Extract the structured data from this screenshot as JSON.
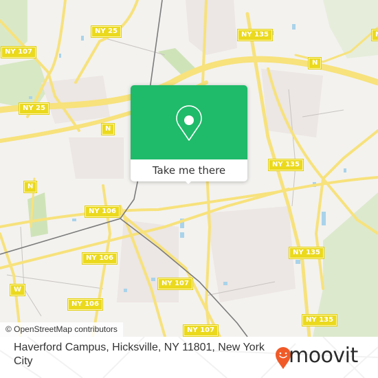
{
  "map": {
    "road_labels": [
      {
        "id": "ny25-top",
        "text": "NY 25"
      },
      {
        "id": "ny107-left",
        "text": "NY 107"
      },
      {
        "id": "ny25-left",
        "text": "NY 25"
      },
      {
        "id": "n-center-left",
        "text": "N"
      },
      {
        "id": "n-left",
        "text": "N"
      },
      {
        "id": "ny135-top",
        "text": "NY 135"
      },
      {
        "id": "n-top-right",
        "text": "N"
      },
      {
        "id": "n-far-right",
        "text": "N"
      },
      {
        "id": "ny135-mid",
        "text": "NY 135"
      },
      {
        "id": "ny106-a",
        "text": "NY 106"
      },
      {
        "id": "ny106-b",
        "text": "NY 106"
      },
      {
        "id": "ny106-c",
        "text": "NY 106"
      },
      {
        "id": "w-left",
        "text": "W"
      },
      {
        "id": "ny107-mid",
        "text": "NY 107"
      },
      {
        "id": "ny135-right",
        "text": "NY 135"
      },
      {
        "id": "ny107-bottom",
        "text": "NY 107"
      },
      {
        "id": "ny135-bottom",
        "text": "NY 135"
      }
    ],
    "attribution": "© OpenStreetMap contributors"
  },
  "popup": {
    "icon": "map-pin-icon",
    "button_label": "Take me there",
    "accent_color": "#1fba6a"
  },
  "footer": {
    "address": "Haverford Campus, Hicksville, NY 11801, New York City",
    "brand": "moovit",
    "brand_color": "#f05a28"
  }
}
